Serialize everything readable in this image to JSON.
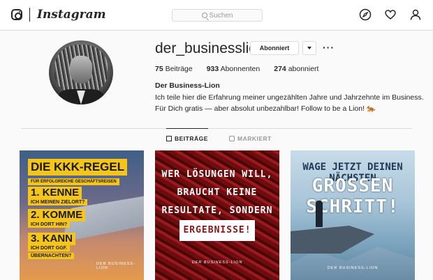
{
  "app": {
    "name": "Instagram"
  },
  "header": {
    "search_placeholder": "Suchen"
  },
  "profile": {
    "username": "der_businesslion",
    "follow_label": "Abonniert",
    "more_label": "···",
    "stats": [
      {
        "count": "75",
        "label": "Beiträge"
      },
      {
        "count": "933",
        "label": "Abonnenten"
      },
      {
        "count": "274",
        "label": "abonniert"
      }
    ],
    "bio_name": "Der Business-Lion",
    "bio_line1": "Ich teile hier die Erfahrung meiner ungezählten Jahre und Jahrzehnte im Business.",
    "bio_line2": "Für Dich gratis — aber absolut unbezahlbar! Follow to be a Lion! 🐅"
  },
  "tabs": [
    {
      "label": "BEITRÄGE",
      "icon": "grid-icon",
      "active": true
    },
    {
      "label": "MARKIERT",
      "icon": "tag-icon",
      "active": false
    }
  ],
  "posts": {
    "p1": {
      "title": "DIE KKK-REGEL",
      "subtitle": "FÜR ERFOLGREICHE GESCHÄFTSREISEN",
      "i1": "1. KENNE",
      "n1": "ICH MEINEN ZIELORT?",
      "i2": "2. KOMME",
      "n2": "ICH DORT HIN?",
      "i3": "3. KANN",
      "n3": "ICH DORT GGF.",
      "n3b": "ÜBERNACHTEN?",
      "brand": "DER BUSINESS-LION"
    },
    "p2": {
      "l1": "WER LÖSUNGEN WILL,",
      "l2": "BRAUCHT KEINE",
      "l3": "RESULTATE, SONDERN",
      "l4": "ERGEBNISSE!",
      "brand": "DER BUSINESS-LION"
    },
    "p3": {
      "l1": "WAGE JETZT DEINEN NÄCHSTEN",
      "l2": "GROSSEN SCHRITT!",
      "brand": "DER BUSINESS-LION"
    }
  }
}
